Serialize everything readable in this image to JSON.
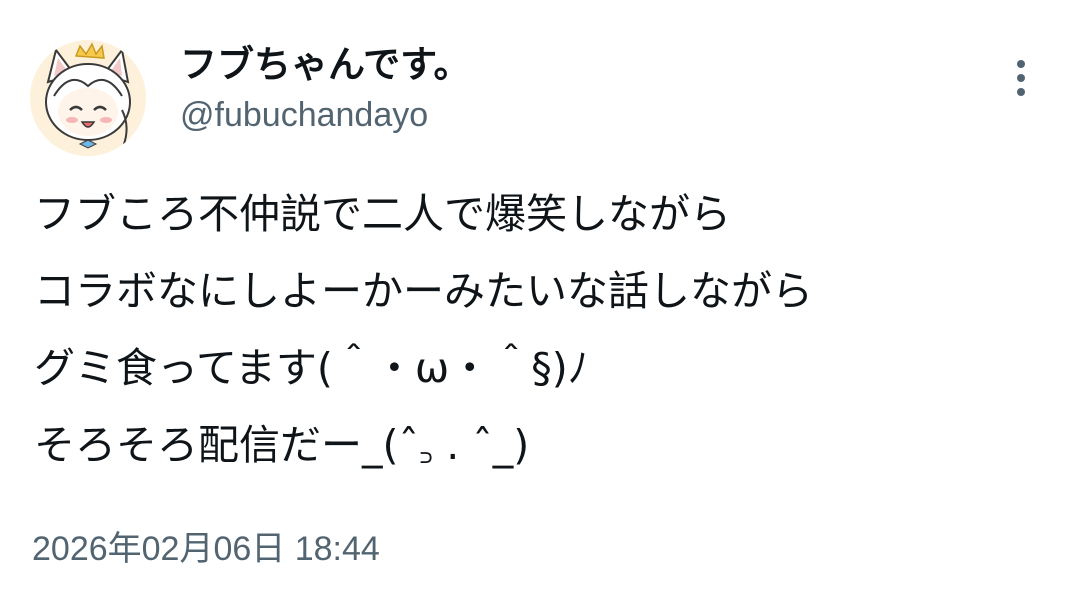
{
  "author": {
    "display_name": "フブちゃんです。",
    "handle": "@fubuchandayo",
    "avatar_icon": "avatar-icon"
  },
  "menu": {
    "icon": "more-vertical-icon"
  },
  "tweet": {
    "lines": [
      "フブころ不仲説で二人で爆笑しながら",
      "コラボなにしよーかーみたいな話しながら",
      "グミ食ってます(＾・ω・＾§)ﾉ",
      "そろそろ配信だー_(ˆ꜆ . ˆ_)"
    ]
  },
  "timestamp": "2026年02月06日 18:44",
  "colors": {
    "text_primary": "#0f1419",
    "text_secondary": "#536471",
    "background": "#ffffff"
  }
}
